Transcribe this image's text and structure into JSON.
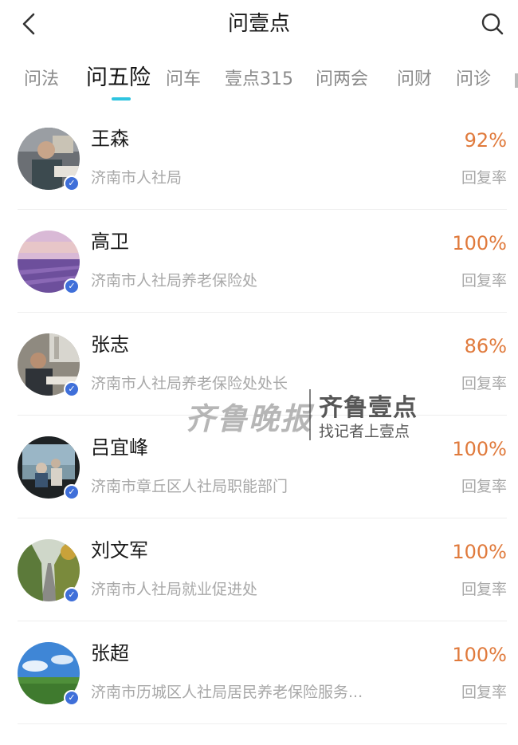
{
  "header": {
    "title": "问壹点",
    "back_icon": "chevron-left-icon",
    "search_icon": "search-icon"
  },
  "tabs": [
    {
      "label": "问法",
      "active": false
    },
    {
      "label": "问五险",
      "active": true
    },
    {
      "label": "问车",
      "active": false
    },
    {
      "label": "壹点315",
      "active": false
    },
    {
      "label": "问两会",
      "active": false
    },
    {
      "label": "问财",
      "active": false
    },
    {
      "label": "问诊",
      "active": false
    }
  ],
  "accent_color": "#2ec4e0",
  "rate_color": "#e07a3c",
  "experts": [
    {
      "name": "王森",
      "org": "济南市人社局",
      "rate": "92%",
      "rate_label": "回复率"
    },
    {
      "name": "高卫",
      "org": "济南市人社局养老保险处",
      "rate": "100%",
      "rate_label": "回复率"
    },
    {
      "name": "张志",
      "org": "济南市人社局养老保险处处长",
      "rate": "86%",
      "rate_label": "回复率"
    },
    {
      "name": "吕宜峰",
      "org": "济南市章丘区人社局职能部门",
      "rate": "100%",
      "rate_label": "回复率"
    },
    {
      "name": "刘文军",
      "org": "济南市人社局就业促进处",
      "rate": "100%",
      "rate_label": "回复率"
    },
    {
      "name": "张超",
      "org": "济南市历城区人社局居民养老保险服务...",
      "rate": "100%",
      "rate_label": "回复率"
    }
  ],
  "watermark": {
    "script": "齐鲁晚报",
    "brand": "齐鲁壹点",
    "tagline": "找记者上壹点"
  }
}
